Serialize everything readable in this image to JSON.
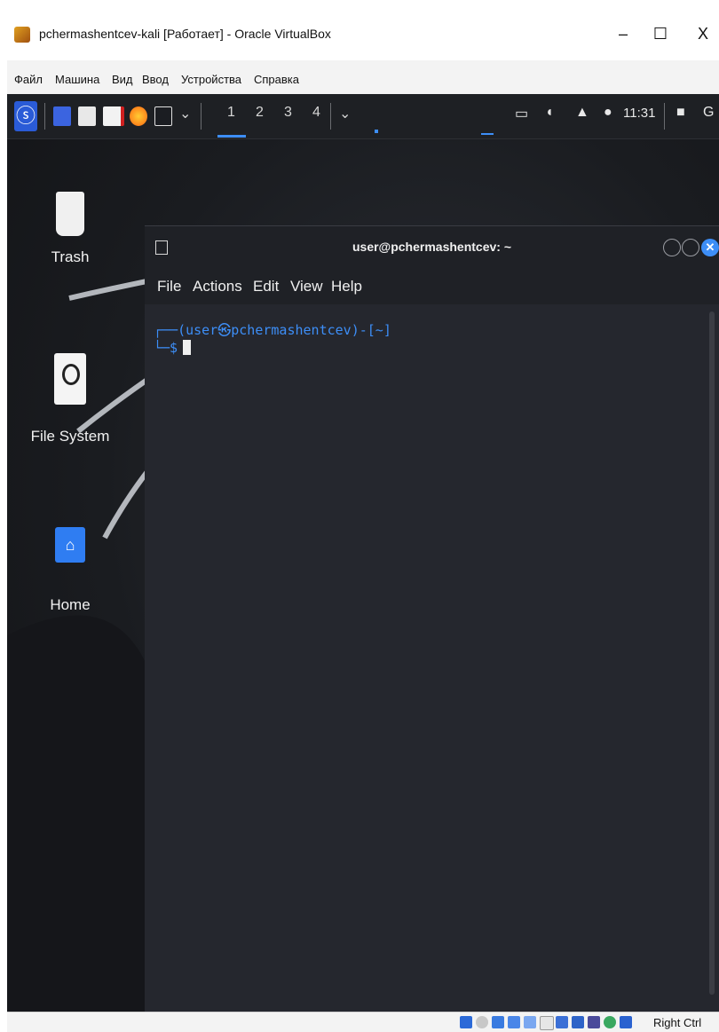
{
  "window": {
    "title": "pchermashentcev-kali [Работает] - Oracle VirtualBox",
    "minimize": "–",
    "maximize": "☐",
    "close": "X"
  },
  "menu": [
    "Файл",
    "Машина",
    "Вид",
    "Ввод",
    "Устройства",
    "Справка"
  ],
  "panel": {
    "kali_menu_glyph": "ⓢ",
    "workspaces": [
      "1",
      "2",
      "3",
      "4"
    ],
    "dropdown": "⌄",
    "clock": "11:31",
    "tray_icons": [
      "monitor-icon",
      "volume-icon",
      "bell-icon",
      "power-icon",
      "lock-icon"
    ]
  },
  "desktop": {
    "icons": [
      {
        "name": "trash",
        "label": "Trash"
      },
      {
        "name": "file-system",
        "label": "File System"
      },
      {
        "name": "home",
        "label": "Home"
      }
    ]
  },
  "terminal": {
    "title": "user@pchermashentcev: ~",
    "menu": [
      "File",
      "Actions",
      "Edit",
      "View",
      "Help"
    ],
    "prompt_line1": "┌──(user㉿pchermashentcev)-[~]",
    "prompt_line2": "└─$"
  },
  "statusbar": {
    "host_key": "Right Ctrl"
  },
  "colors": {
    "accent": "#3d8ef7",
    "panel_bg": "#1e2024",
    "terminal_bg": "#25272e"
  }
}
